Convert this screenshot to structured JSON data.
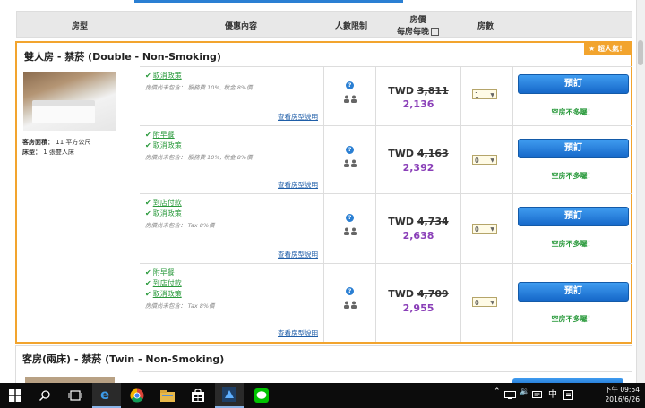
{
  "header": {
    "col_room_type": "房型",
    "col_benefits": "優惠內容",
    "col_occupancy": "人數限制",
    "col_price_line1": "房價",
    "col_price_line2": "每房每晚",
    "col_rooms": "房數"
  },
  "room1": {
    "title": "雙人房 - 禁菸 (Double - Non-Smoking)",
    "badge": "超人氣！",
    "area_label": "客房面積：",
    "area_value": "11 平方公尺",
    "bed_label": "床型：",
    "bed_value": "1 張雙人床"
  },
  "room2": {
    "title": "客房(兩床) - 禁菸 (Twin - Non-Smoking)"
  },
  "rates": [
    {
      "features": [
        "取消政策"
      ],
      "note": "房價尚未包含： 服務費 10%, 稅金 8%價",
      "details": "查看房型說明",
      "old_price": "TWD 3,811",
      "new_price": "2,136",
      "qty": "1",
      "book": "預訂",
      "avail": "空房不多囉！"
    },
    {
      "features": [
        "附早餐",
        "取消政策"
      ],
      "note": "房價尚未包含： 服務費 10%, 稅金 8%價",
      "details": "查看房型說明",
      "old_price": "TWD 4,163",
      "new_price": "2,392",
      "qty": "0",
      "book": "預訂",
      "avail": "空房不多囉！"
    },
    {
      "features": [
        "到店付款",
        "取消政策"
      ],
      "note": "房價尚未包含： Tax 8%價",
      "details": "查看房型說明",
      "old_price": "TWD 4,734",
      "new_price": "2,638",
      "qty": "0",
      "book": "預訂",
      "avail": "空房不多囉！"
    },
    {
      "features": [
        "附早餐",
        "到店付款",
        "取消政策"
      ],
      "note": "房價尚未包含： Tax 8%價",
      "details": "查看房型說明",
      "old_price": "TWD 4,709",
      "new_price": "2,955",
      "qty": "0",
      "book": "預訂",
      "avail": "空房不多囉！"
    }
  ],
  "taskbar": {
    "icons": [
      "windows-icon",
      "search-icon",
      "task-view-icon",
      "edge-icon",
      "chrome-icon",
      "file-explorer-icon",
      "store-icon",
      "app-icon",
      "line-icon"
    ],
    "tray_ime": "中",
    "time": "下午 09:54",
    "date": "2016/6/26"
  },
  "colors": {
    "accent": "#2a7fd3",
    "highlight": "#f2a42e",
    "price": "#8a3fb8",
    "available": "#2a9a3c"
  }
}
